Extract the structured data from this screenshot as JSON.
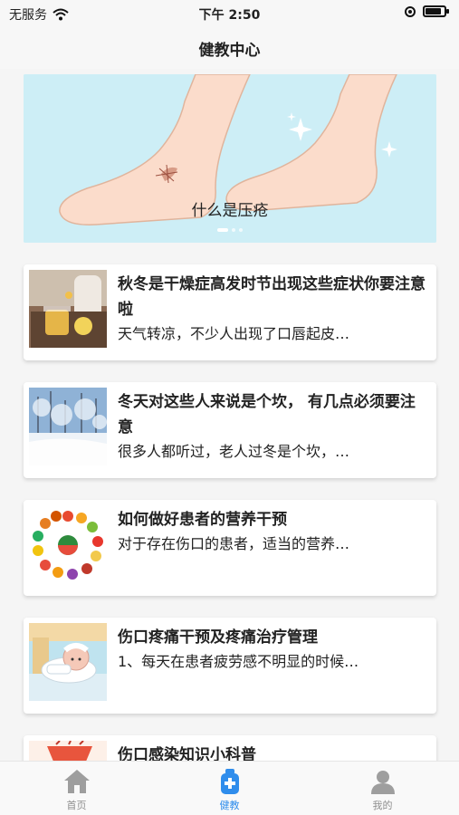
{
  "status_bar": {
    "carrier": "无服务",
    "time": "下午 2:50",
    "battery_level": 0.85
  },
  "nav": {
    "title": "健教中心"
  },
  "banner": {
    "caption": "什么是压疮",
    "slide_count": 3,
    "active_slide": 1
  },
  "articles": [
    {
      "title": "秋冬是干燥症高发时节出现这些症状你要注意啦",
      "summary": "天气转凉，不少人出现了口唇起皮…",
      "thumb_icon": "lemon-drink-photo"
    },
    {
      "title": "冬天对这些人来说是个坎， 有几点必须要注意",
      "summary": "很多人都听过，老人过冬是个坎，…",
      "thumb_icon": "snowy-forest-photo"
    },
    {
      "title": "如何做好患者的营养干预",
      "summary": "对于存在伤口的患者，适当的营养…",
      "thumb_icon": "fruit-ring-illustration"
    },
    {
      "title": "伤口疼痛干预及疼痛治疗管理",
      "summary": "1、每天在患者疲劳感不明显的时候…",
      "thumb_icon": "bandaged-patient-illustration"
    },
    {
      "title": "伤口感染知识小科普",
      "summary": "",
      "thumb_icon": "infection-illustration"
    }
  ],
  "tabs": [
    {
      "label": "首页",
      "icon": "home-icon",
      "active": false
    },
    {
      "label": "健教",
      "icon": "health-education-icon",
      "active": true
    },
    {
      "label": "我的",
      "icon": "profile-icon",
      "active": false
    }
  ],
  "colors": {
    "accent": "#2f8dec",
    "inactive": "#8e8e8e",
    "banner_bg": "#cdeef6"
  }
}
